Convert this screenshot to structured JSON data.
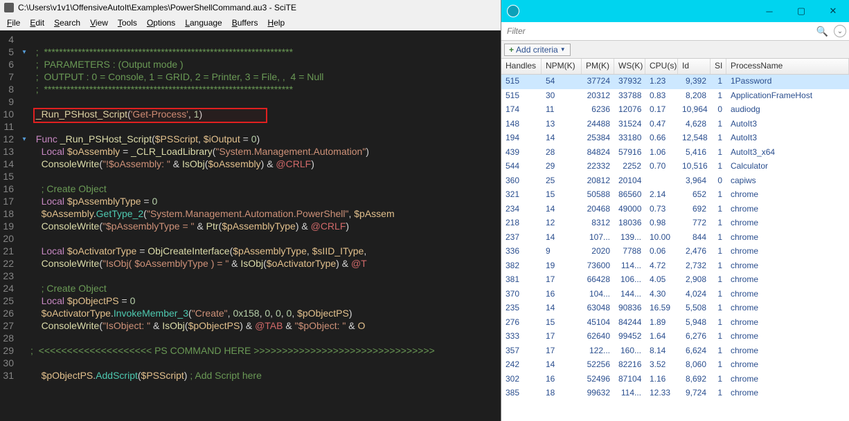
{
  "editor": {
    "title": "C:\\Users\\v1v1\\OffensiveAutoIt\\Examples\\PowerShellCommand.au3 - SciTE",
    "menus": [
      "File",
      "Edit",
      "Search",
      "View",
      "Tools",
      "Options",
      "Language",
      "Buffers",
      "Help"
    ],
    "line_numbers": [
      4,
      5,
      6,
      7,
      8,
      9,
      10,
      11,
      12,
      13,
      14,
      15,
      16,
      17,
      18,
      19,
      20,
      21,
      22,
      23,
      24,
      25,
      26,
      27,
      28,
      29,
      30,
      31
    ],
    "lines": {
      "l5": "  ;  ******************************************************************",
      "l6_a": "  ;  PARAMETERS : (Output mode )",
      "l7_a": "  ;  OUTPUT : 0 = Console, 1 = GRID, 2 = Printer, 3 = File, ,  4 = Null",
      "l8": "  ;  ******************************************************************",
      "l10_func": "_Run_PSHost_Script",
      "l10_str": "'Get-Process'",
      "l10_num": "1",
      "l12_kw": "Func",
      "l12_name": "_Run_PSHost_Script",
      "l12_p1": "$PSScript",
      "l12_p2": "$iOutput",
      "l12_v": "0",
      "l13_kw": "Local",
      "l13_var": "$oAssembly",
      "l13_fn": "_CLR_LoadLibrary",
      "l13_str": "\"System.Management.Automation\"",
      "l14_fn": "ConsoleWrite",
      "l14_str": "\"!$oAssembly: \"",
      "l14_isobj": "IsObj",
      "l14_v": "$oAssembly",
      "l14_m": "@CRLF",
      "l16": "    ; Create Object",
      "l17_kw": "Local",
      "l17_var": "$pAssemblyType",
      "l17_v": "0",
      "l18_o": "$oAssembly",
      "l18_m": "GetType_2",
      "l18_s": "\"System.Management.Automation.PowerShell\"",
      "l18_v": "$pAssem",
      "l19_fn": "ConsoleWrite",
      "l19_s": "\"$pAssemblyType = \"",
      "l19_ptr": "Ptr",
      "l19_v": "$pAssemblyType",
      "l19_m": "@CRLF",
      "l21_kw": "Local",
      "l21_var": "$oActivatorType",
      "l21_fn": "ObjCreateInterface",
      "l21_a": "$pAssemblyType",
      "l21_b": "$sIID_IType",
      "l22_fn": "ConsoleWrite",
      "l22_s": "\"IsObj( $oAssemblyType ) = \"",
      "l22_is": "IsObj",
      "l22_v": "$oActivatorType",
      "l22_m": "@T",
      "l24": "    ; Create Object",
      "l25_kw": "Local",
      "l25_var": "$pObjectPS",
      "l25_v": "0",
      "l26_o": "$oActivatorType",
      "l26_m": "InvokeMember_3",
      "l26_s": "\"Create\"",
      "l26_h": "0x158",
      "l26_z": "0",
      "l26_v": "$pObjectPS",
      "l27_fn": "ConsoleWrite",
      "l27_s1": "\"IsObject: \"",
      "l27_is": "IsObj",
      "l27_v": "$pObjectPS",
      "l27_t": "@TAB",
      "l27_s2": "\"$pObject: \"",
      "l27_o": "O",
      "l29": ";  <<<<<<<<<<<<<<<<<<<< PS COMMAND HERE >>>>>>>>>>>>>>>>>>>>>>>>>>>>>>>>",
      "l31_o": "$pObjectPS",
      "l31_m": "AddScript",
      "l31_v": "$PSScript",
      "l31_c": " ; Add Script here"
    }
  },
  "grid": {
    "filter_placeholder": "Filter",
    "add_criteria": "Add criteria",
    "headers": [
      "Handles",
      "NPM(K)",
      "PM(K)",
      "WS(K)",
      "CPU(s)",
      "Id",
      "SI",
      "ProcessName"
    ],
    "rows": [
      {
        "h": "515",
        "n": "54",
        "p": "37724",
        "w": "37932",
        "c": "1.23",
        "i": "9,392",
        "s": "1",
        "name": "1Password",
        "sel": true
      },
      {
        "h": "515",
        "n": "30",
        "p": "20312",
        "w": "33788",
        "c": "0.83",
        "i": "8,208",
        "s": "1",
        "name": "ApplicationFrameHost"
      },
      {
        "h": "174",
        "n": "11",
        "p": "6236",
        "w": "12076",
        "c": "0.17",
        "i": "10,964",
        "s": "0",
        "name": "audiodg"
      },
      {
        "h": "148",
        "n": "13",
        "p": "24488",
        "w": "31524",
        "c": "0.47",
        "i": "4,628",
        "s": "1",
        "name": "AutoIt3"
      },
      {
        "h": "194",
        "n": "14",
        "p": "25384",
        "w": "33180",
        "c": "0.66",
        "i": "12,548",
        "s": "1",
        "name": "AutoIt3"
      },
      {
        "h": "439",
        "n": "28",
        "p": "84824",
        "w": "57916",
        "c": "1.06",
        "i": "5,416",
        "s": "1",
        "name": "AutoIt3_x64"
      },
      {
        "h": "544",
        "n": "29",
        "p": "22332",
        "w": "2252",
        "c": "0.70",
        "i": "10,516",
        "s": "1",
        "name": "Calculator"
      },
      {
        "h": "360",
        "n": "25",
        "p": "20812",
        "w": "20104",
        "c": "",
        "i": "3,964",
        "s": "0",
        "name": "capiws"
      },
      {
        "h": "321",
        "n": "15",
        "p": "50588",
        "w": "86560",
        "c": "2.14",
        "i": "652",
        "s": "1",
        "name": "chrome"
      },
      {
        "h": "234",
        "n": "14",
        "p": "20468",
        "w": "49000",
        "c": "0.73",
        "i": "692",
        "s": "1",
        "name": "chrome"
      },
      {
        "h": "218",
        "n": "12",
        "p": "8312",
        "w": "18036",
        "c": "0.98",
        "i": "772",
        "s": "1",
        "name": "chrome"
      },
      {
        "h": "237",
        "n": "14",
        "p": "107...",
        "w": "139...",
        "c": "10.00",
        "i": "844",
        "s": "1",
        "name": "chrome"
      },
      {
        "h": "336",
        "n": "9",
        "p": "2020",
        "w": "7788",
        "c": "0.06",
        "i": "2,476",
        "s": "1",
        "name": "chrome"
      },
      {
        "h": "382",
        "n": "19",
        "p": "73600",
        "w": "114...",
        "c": "4.72",
        "i": "2,732",
        "s": "1",
        "name": "chrome"
      },
      {
        "h": "381",
        "n": "17",
        "p": "66428",
        "w": "106...",
        "c": "4.05",
        "i": "2,908",
        "s": "1",
        "name": "chrome"
      },
      {
        "h": "370",
        "n": "16",
        "p": "104...",
        "w": "144...",
        "c": "4.30",
        "i": "4,024",
        "s": "1",
        "name": "chrome"
      },
      {
        "h": "235",
        "n": "14",
        "p": "63048",
        "w": "90836",
        "c": "16.59",
        "i": "5,508",
        "s": "1",
        "name": "chrome"
      },
      {
        "h": "276",
        "n": "15",
        "p": "45104",
        "w": "84244",
        "c": "1.89",
        "i": "5,948",
        "s": "1",
        "name": "chrome"
      },
      {
        "h": "333",
        "n": "17",
        "p": "62640",
        "w": "99452",
        "c": "1.64",
        "i": "6,276",
        "s": "1",
        "name": "chrome"
      },
      {
        "h": "357",
        "n": "17",
        "p": "122...",
        "w": "160...",
        "c": "8.14",
        "i": "6,624",
        "s": "1",
        "name": "chrome"
      },
      {
        "h": "242",
        "n": "14",
        "p": "52256",
        "w": "82216",
        "c": "3.52",
        "i": "8,060",
        "s": "1",
        "name": "chrome"
      },
      {
        "h": "302",
        "n": "16",
        "p": "52496",
        "w": "87104",
        "c": "1.16",
        "i": "8,692",
        "s": "1",
        "name": "chrome"
      },
      {
        "h": "385",
        "n": "18",
        "p": "99632",
        "w": "114...",
        "c": "12.33",
        "i": "9,724",
        "s": "1",
        "name": "chrome"
      }
    ]
  }
}
